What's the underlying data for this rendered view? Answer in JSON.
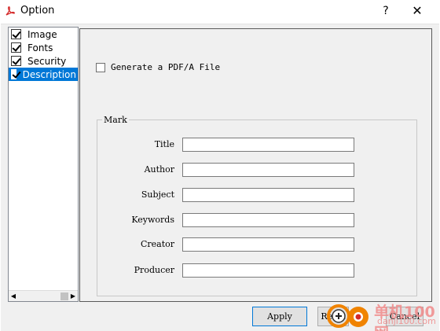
{
  "window": {
    "title": "Option",
    "help_label": "?",
    "close_label": "✕",
    "icon": "pdf-icon"
  },
  "tree": {
    "items": [
      {
        "label": "Image",
        "checked": true,
        "selected": false
      },
      {
        "label": "Fonts",
        "checked": true,
        "selected": false
      },
      {
        "label": "Security",
        "checked": true,
        "selected": false
      },
      {
        "label": "Description",
        "checked": true,
        "selected": true
      }
    ],
    "scroll_left": "◀",
    "scroll_right": "▶"
  },
  "description": {
    "pdfa_label": "Generate a PDF/A File",
    "pdfa_checked": false,
    "group_title": "Mark",
    "fields": [
      {
        "label": "Title",
        "value": ""
      },
      {
        "label": "Author",
        "value": ""
      },
      {
        "label": "Subject",
        "value": ""
      },
      {
        "label": "Keywords",
        "value": ""
      },
      {
        "label": "Creator",
        "value": ""
      },
      {
        "label": "Producer",
        "value": ""
      }
    ]
  },
  "buttons": {
    "apply": "Apply",
    "reset": "Reset",
    "cancel": "Cancel"
  },
  "watermark": {
    "text": "单机100网",
    "sub": "danji100.com"
  },
  "colors": {
    "selection": "#0078d7",
    "watermark": "#f08a8a",
    "logo_orange": "#f08300"
  }
}
